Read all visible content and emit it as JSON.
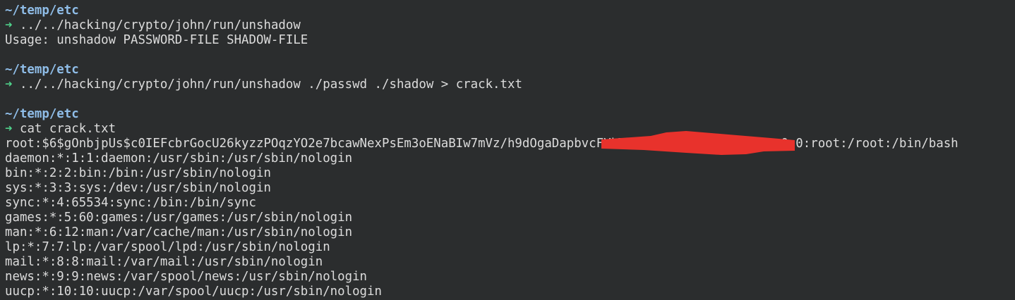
{
  "colors": {
    "background": "#2b2d2e",
    "cwd": "#8fbde8",
    "prompt_arrow": "#4fd08a",
    "text": "#dcdcdc",
    "redaction": "#e8322c"
  },
  "prompt_symbol": "➜",
  "blocks": [
    {
      "cwd": "~/temp/etc",
      "command": "../../hacking/crypto/john/run/unshadow",
      "output": [
        "Usage: unshadow PASSWORD-FILE SHADOW-FILE"
      ]
    },
    {
      "cwd": "~/temp/etc",
      "command": "../../hacking/crypto/john/run/unshadow ./passwd ./shadow > crack.txt",
      "output": []
    },
    {
      "cwd": "~/temp/etc",
      "command": "cat crack.txt",
      "output": [
        "root:$6$gOnbjpUs$c0IEFcbrGocU26kyzzPOqzYO2e7bcawNexPsEm3oENaBIw7mVz/h9dOgaDapbvcFYkT7zJq8mWcLrdTg3RJFxi1:0:0:root:/root:/bin/bash",
        "daemon:*:1:1:daemon:/usr/sbin:/usr/sbin/nologin",
        "bin:*:2:2:bin:/bin:/usr/sbin/nologin",
        "sys:*:3:3:sys:/dev:/usr/sbin/nologin",
        "sync:*:4:65534:sync:/bin:/bin/sync",
        "games:*:5:60:games:/usr/games:/usr/sbin/nologin",
        "man:*:6:12:man:/var/cache/man:/usr/sbin/nologin",
        "lp:*:7:7:lp:/var/spool/lpd:/usr/sbin/nologin",
        "mail:*:8:8:mail:/var/mail:/usr/sbin/nologin",
        "news:*:9:9:news:/var/spool/news:/usr/sbin/nologin",
        "uucp:*:10:10:uucp:/var/spool/uucp:/usr/sbin/nologin"
      ]
    }
  ]
}
